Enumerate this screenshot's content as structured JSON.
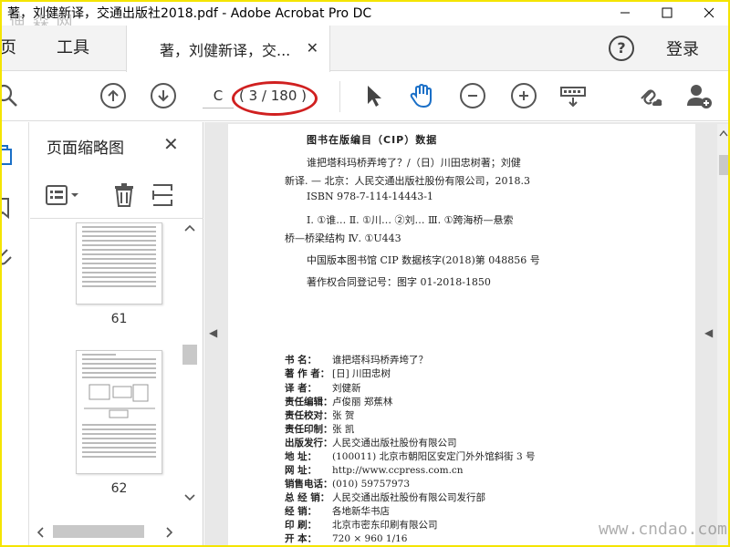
{
  "window": {
    "title": "著，刘健新译，交通出版社2018.pdf - Adobe Acrobat Pro DC",
    "watermark_top": "迪 森 网"
  },
  "tabs": {
    "home": "主页",
    "tools": "工具",
    "document": "著，刘健新译，交...",
    "login": "登录"
  },
  "toolbar": {
    "page_input": "C",
    "page_count": "( 3 / 180 )"
  },
  "thumbnail_panel": {
    "title": "页面缩略图",
    "pages": [
      "61",
      "62"
    ]
  },
  "document": {
    "cip_heading": "图书在版编目（CIP）数据",
    "cip_lines": [
      "谁把塔科玛桥弄垮了？/（日）川田忠树著；刘健",
      "新译. — 北京：人民交通出版社股份有限公司，2018.3",
      "ISBN 978-7-114-14443-1",
      "Ⅰ. ①谁… Ⅱ. ①川… ②刘… Ⅲ. ①跨海桥—悬索",
      "桥—桥梁结构 Ⅳ. ①U443",
      "中国版本图书馆 CIP 数据核字(2018)第 048856 号",
      "著作权合同登记号：图字 01-2018-1850"
    ],
    "specs": [
      {
        "label": "书 名：",
        "value": "谁把塔科玛桥弄垮了？"
      },
      {
        "label": "著 作 者：",
        "value": "[日] 川田忠树"
      },
      {
        "label": "译 者：",
        "value": "刘健新"
      },
      {
        "label": "责任编辑：",
        "value": "卢俊丽 郑蕉林"
      },
      {
        "label": "责任校对：",
        "value": "张 贺"
      },
      {
        "label": "责任印制：",
        "value": "张 凯"
      },
      {
        "label": "出版发行：",
        "value": "人民交通出版社股份有限公司"
      },
      {
        "label": "地 址：",
        "value": "(100011) 北京市朝阳区安定门外外馆斜街 3 号"
      },
      {
        "label": "网 址：",
        "value": "http://www.ccpress.com.cn"
      },
      {
        "label": "销售电话：",
        "value": "(010) 59757973"
      },
      {
        "label": "总 经 销：",
        "value": "人民交通出版社股份有限公司发行部"
      },
      {
        "label": "经 销：",
        "value": "各地新华书店"
      },
      {
        "label": "印 刷：",
        "value": "北京市密东印刷有限公司"
      },
      {
        "label": "开 本：",
        "value": "720 × 960 1/16"
      }
    ],
    "watermark_bottom": "www.cndao.com"
  },
  "colors": {
    "accent_annotation": "#d02020",
    "frame": "#f4e400"
  }
}
